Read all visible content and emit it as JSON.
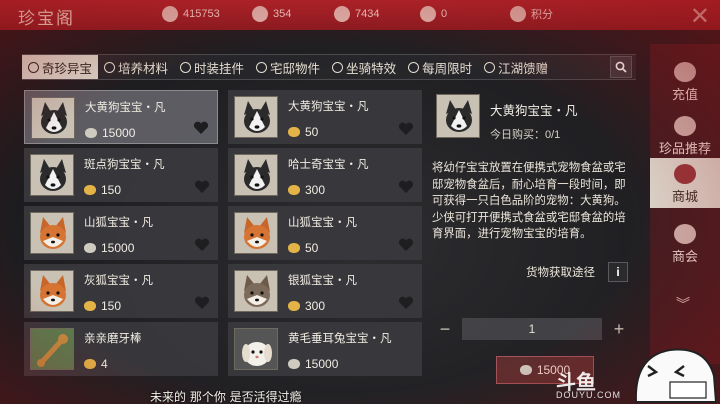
{
  "header": {
    "title": "珍宝阁",
    "currencies": [
      {
        "icon": "rose-coin-icon",
        "value": "415753"
      },
      {
        "icon": "jade-icon",
        "value": "354"
      },
      {
        "icon": "horse-token-icon",
        "value": "7434"
      },
      {
        "icon": "silver-ingot-icon",
        "value": "0"
      },
      {
        "icon": "points-icon",
        "value": "积分"
      }
    ]
  },
  "tabs": [
    {
      "label": "奇珍异宝",
      "active": true
    },
    {
      "label": "培养材料"
    },
    {
      "label": "时装挂件"
    },
    {
      "label": "宅邸物件"
    },
    {
      "label": "坐骑特效"
    },
    {
      "label": "每周限时"
    },
    {
      "label": "江湖馈赠"
    }
  ],
  "items": [
    {
      "name": "大黄狗宝宝・凡",
      "price": "15000",
      "currency": "silver",
      "pet": "husky",
      "active": true
    },
    {
      "name": "大黄狗宝宝・凡",
      "price": "50",
      "currency": "gold",
      "pet": "husky"
    },
    {
      "name": "斑点狗宝宝・凡",
      "price": "150",
      "currency": "gold",
      "pet": "husky"
    },
    {
      "name": "哈士奇宝宝・凡",
      "price": "300",
      "currency": "gold",
      "pet": "husky"
    },
    {
      "name": "山狐宝宝・凡",
      "price": "15000",
      "currency": "silver",
      "pet": "fox"
    },
    {
      "name": "山狐宝宝・凡",
      "price": "50",
      "currency": "gold",
      "pet": "fox"
    },
    {
      "name": "灰狐宝宝・凡",
      "price": "150",
      "currency": "gold",
      "pet": "fox"
    },
    {
      "name": "银狐宝宝・凡",
      "price": "300",
      "currency": "gold",
      "pet": "fox"
    },
    {
      "name": "亲亲磨牙棒",
      "price": "4",
      "currency": "gold",
      "pet": "stick"
    },
    {
      "name": "黄毛垂耳兔宝宝・凡",
      "price": "15000",
      "currency": "silver",
      "pet": "rabbit"
    }
  ],
  "detail": {
    "name": "大黄狗宝宝・凡",
    "limit": "今日购买：0/1",
    "description": "将幼仔宝宝放置在便携式宠物食盆或宅邸宠物食盆后，耐心培育一段时间，即可获得一只白色品阶的宠物：大黄狗。少侠可打开便携式食盆或宅邸食盆的培育界面，进行宠物宝宝的培育。",
    "source_label": "货物获取途径",
    "info_label": "i",
    "quantity": "1",
    "minus": "−",
    "plus": "+",
    "buy_price": "15000"
  },
  "right_nav": [
    {
      "label": "充值",
      "icon": "recharge-icon"
    },
    {
      "label": "珍品推荐",
      "icon": "treasure-icon"
    },
    {
      "label": "商城",
      "icon": "shop-icon",
      "active": true
    },
    {
      "label": "商会",
      "icon": "guild-icon"
    }
  ],
  "overlay": {
    "subtitle": "未来的 那个你 是否活得过瘾",
    "watermark": "斗鱼",
    "watermark_sub": "DOUYU.COM"
  },
  "colors": {
    "accent_red": "#b0252b",
    "gold": "#e3b347"
  }
}
